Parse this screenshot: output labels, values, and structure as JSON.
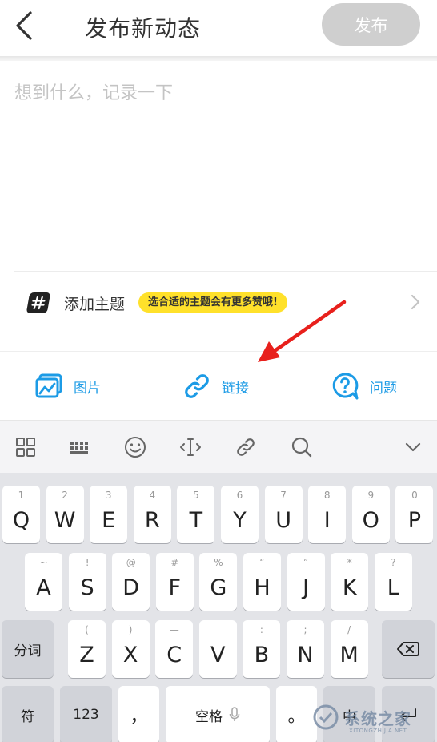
{
  "header": {
    "title": "发布新动态",
    "publish_label": "发布"
  },
  "editor": {
    "placeholder": "想到什么，记录一下"
  },
  "topic": {
    "label": "添加主题",
    "tip": "选合适的主题会有更多赞哦!"
  },
  "media": {
    "items": [
      {
        "label": "图片",
        "icon": "image-icon"
      },
      {
        "label": "链接",
        "icon": "link-icon"
      },
      {
        "label": "问题",
        "icon": "question-icon"
      }
    ],
    "accent": "#1c9be6"
  },
  "keyboard_toolbar": {
    "icons": [
      "grid-icon",
      "keyboard-icon",
      "emoji-icon",
      "cursor-icon",
      "clipboard-link-icon",
      "search-icon",
      "chevron-down-icon"
    ]
  },
  "keyboard": {
    "row1": [
      {
        "k": "Q",
        "s": "1"
      },
      {
        "k": "W",
        "s": "2"
      },
      {
        "k": "E",
        "s": "3"
      },
      {
        "k": "R",
        "s": "4"
      },
      {
        "k": "T",
        "s": "5"
      },
      {
        "k": "Y",
        "s": "6"
      },
      {
        "k": "U",
        "s": "7"
      },
      {
        "k": "I",
        "s": "8"
      },
      {
        "k": "O",
        "s": "9"
      },
      {
        "k": "P",
        "s": "0"
      }
    ],
    "row2": [
      {
        "k": "A",
        "s": "~"
      },
      {
        "k": "S",
        "s": "!"
      },
      {
        "k": "D",
        "s": "@"
      },
      {
        "k": "F",
        "s": "#"
      },
      {
        "k": "G",
        "s": "%"
      },
      {
        "k": "H",
        "s": "“"
      },
      {
        "k": "J",
        "s": "”"
      },
      {
        "k": "K",
        "s": "*"
      },
      {
        "k": "L",
        "s": "?"
      }
    ],
    "row3": [
      {
        "k": "Z",
        "s": "("
      },
      {
        "k": "X",
        "s": ")"
      },
      {
        "k": "C",
        "s": "—"
      },
      {
        "k": "V",
        "s": "_"
      },
      {
        "k": "B",
        "s": ":"
      },
      {
        "k": "N",
        "s": ";"
      },
      {
        "k": "M",
        "s": "/"
      }
    ],
    "segment_label": "分词",
    "symbol_label": "符",
    "number_label": "123",
    "comma_label": "，",
    "space_label": "空格",
    "period_label": "。",
    "lang_label": "中"
  },
  "watermark": {
    "text": "系统之家",
    "url": "XITONGZHIJIA.NET"
  }
}
